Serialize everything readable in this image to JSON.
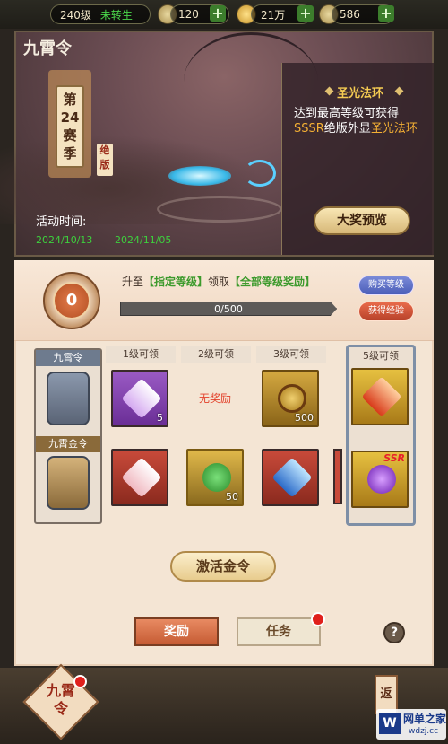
{
  "topbar": {
    "level": "240级",
    "rebirth": "未转生",
    "currency1": "120",
    "currency2": "21万",
    "currency3": "586"
  },
  "banner": {
    "title": "九霄令",
    "season_lines": [
      "第",
      "24",
      "赛",
      "季"
    ],
    "exclusive": "绝版",
    "time_label": "活动时间:",
    "time_start": "2024/10/13",
    "time_end": "2024/11/05",
    "halo_title": "圣光法环",
    "halo_desc_a": "达到最高等级可获得",
    "halo_desc_b": "SSSR",
    "halo_desc_c": "绝版外显",
    "halo_desc_d": "圣光法环",
    "preview_btn": "大奖预览"
  },
  "level": {
    "current": "0",
    "desc_a": "升至",
    "desc_b": "【指定等级】",
    "desc_c": "领取",
    "desc_d": "【全部等级奖励】",
    "progress_text": "0/500",
    "progress_fraction": 0,
    "buy_level": "购买等级",
    "get_exp": "获得经验"
  },
  "rows": {
    "free": "九霄令",
    "gold": "九霄金令"
  },
  "columns": [
    {
      "head": "1级可领",
      "free_count": "5",
      "gold_count": ""
    },
    {
      "head": "2级可领",
      "free_text": "无奖励",
      "gold_count": "50"
    },
    {
      "head": "3级可领",
      "free_count": "500",
      "gold_count": ""
    },
    {
      "head": "5级可领",
      "free_count": "",
      "gold_badge": "SSR"
    }
  ],
  "colors": {
    "green_time": "#3dd13d",
    "accent_orange": "#f4b034",
    "red_dot": "#e0201c"
  },
  "actions": {
    "activate": "激活金令",
    "reward_tab": "奖励",
    "task_tab": "任务",
    "help": "?"
  },
  "bottom": {
    "tab_label": "九霄令",
    "back": "返",
    "wm_text1": "网单之家",
    "wm_text2": "wdzj.cc",
    "wm_logo": "W"
  }
}
